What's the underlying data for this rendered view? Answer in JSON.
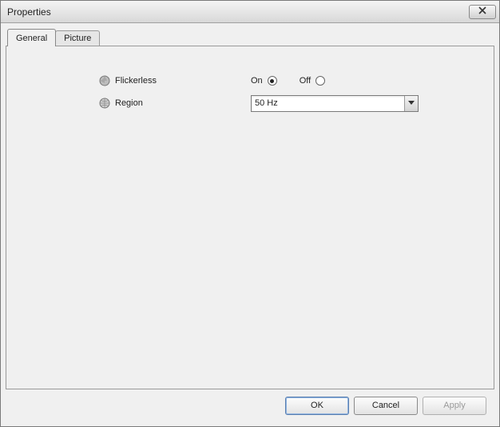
{
  "window": {
    "title": "Properties"
  },
  "tabs": {
    "general": "General",
    "picture": "Picture"
  },
  "form": {
    "flickerless": {
      "label": "Flickerless",
      "on_label": "On",
      "off_label": "Off",
      "value": "On"
    },
    "region": {
      "label": "Region",
      "value": "50 Hz"
    }
  },
  "buttons": {
    "ok": "OK",
    "cancel": "Cancel",
    "apply": "Apply"
  }
}
